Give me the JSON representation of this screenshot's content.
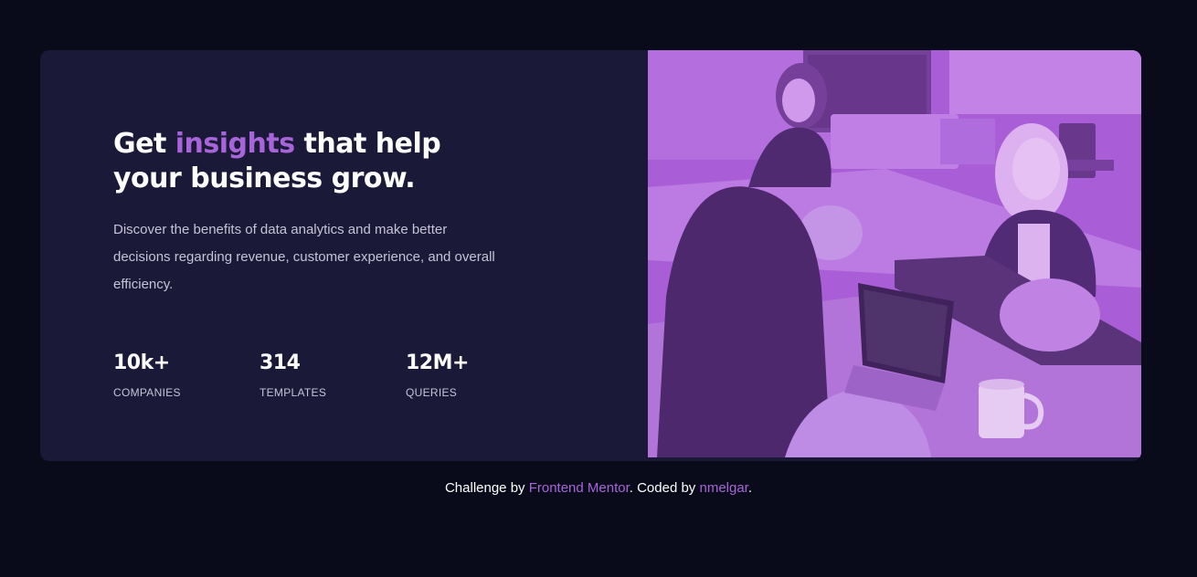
{
  "card": {
    "title_before": "Get ",
    "title_accent": "insights",
    "title_after": " that help your business grow.",
    "description": "Discover the benefits of data analytics and make better decisions regarding revenue, customer experience, and overall efficiency.",
    "stats": [
      {
        "value": "10k+",
        "label": "COMPANIES"
      },
      {
        "value": "314",
        "label": "TEMPLATES"
      },
      {
        "value": "12M+",
        "label": "QUERIES"
      }
    ],
    "image_subject": "people-working-at-table-photo"
  },
  "footer": {
    "prefix": "Challenge by ",
    "link1": "Frontend Mentor",
    "middle": ". Coded by ",
    "link2": "nmelgar",
    "suffix": "."
  },
  "colors": {
    "page_bg": "#090b1a",
    "card_bg": "#1b1938",
    "accent": "#a865d9",
    "text_muted": "#c5c3d6"
  }
}
